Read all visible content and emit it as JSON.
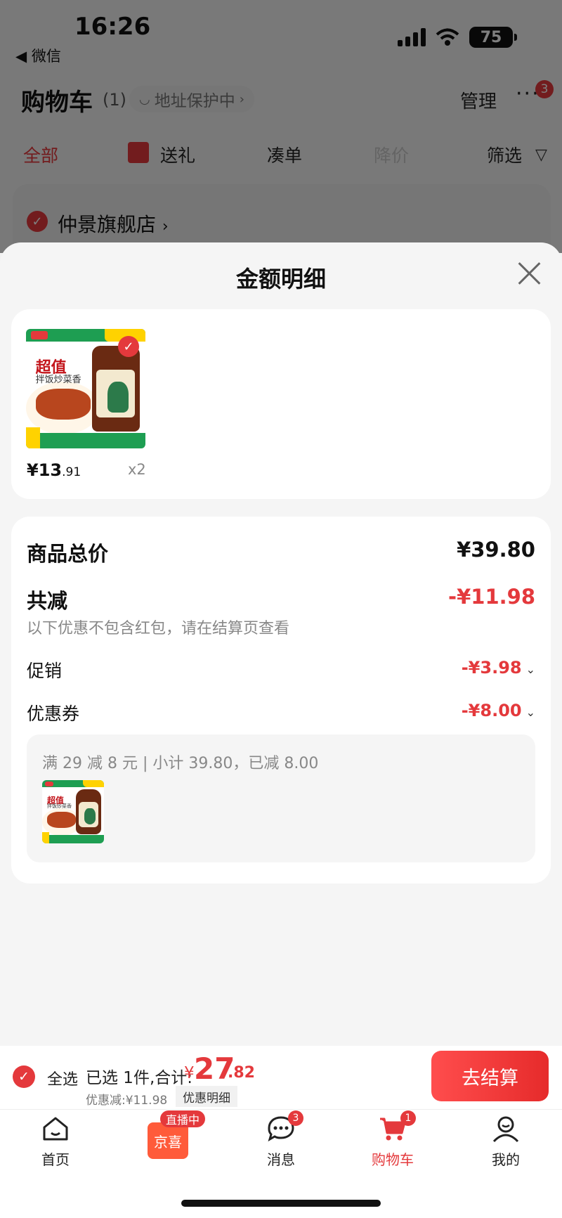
{
  "status_bar": {
    "time": "16:26",
    "back_label": "◀ 微信",
    "battery": "75"
  },
  "header": {
    "title": "购物车",
    "count": "(1)",
    "address_label": "地址保护中",
    "manage": "管理",
    "more_badge": "3"
  },
  "tabs": {
    "all": "全部",
    "gift": "送礼",
    "pile": "凑单",
    "price_drop": "降价",
    "filter": "筛选"
  },
  "store": {
    "name": "仲景旗舰店"
  },
  "sheet": {
    "title": "金额明细",
    "product": {
      "price_main": "¥13",
      "price_decimal": ".91",
      "qty": "x2"
    },
    "total_label": "商品总价",
    "total_value": "¥39.80",
    "reduce_label": "共减",
    "reduce_value": "-¥11.98",
    "note": "以下优惠不包含红包，请在结算页查看",
    "promo_label": "促销",
    "promo_value": "-¥3.98",
    "coupon_label": "优惠券",
    "coupon_value": "-¥8.00",
    "coupon_detail": "满 29 减 8 元 | 小计 39.80，已减 8.00"
  },
  "bottom_bar": {
    "select_all": "全选",
    "selected_summary": "已选 1件,合计:",
    "currency": "¥",
    "total_int": "27",
    "total_dec": ".82",
    "discount_text": "优惠减:¥11.98",
    "discount_btn": "优惠明细",
    "checkout": "去结算"
  },
  "tab_bar": {
    "home": "首页",
    "live_tag": "直播中",
    "live_box": "京喜",
    "messages": "消息",
    "messages_badge": "3",
    "cart": "购物车",
    "cart_badge": "1",
    "me": "我的"
  },
  "colors": {
    "accent": "#e4393c",
    "green": "#1e9e52"
  }
}
